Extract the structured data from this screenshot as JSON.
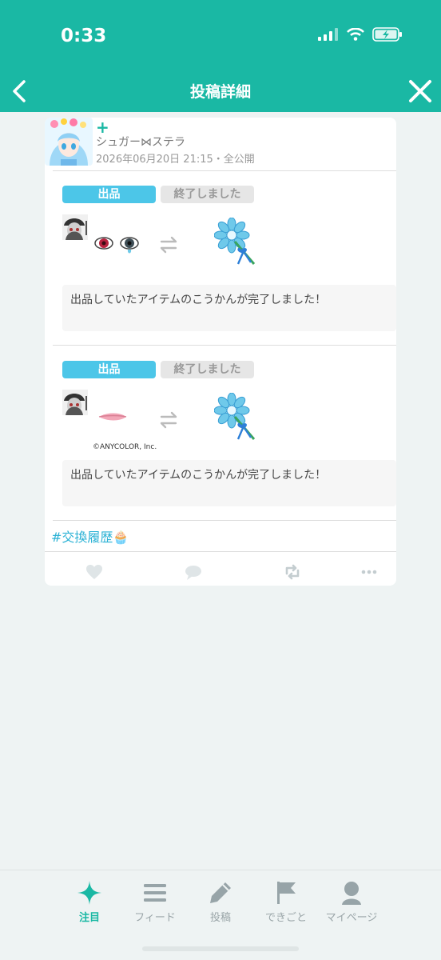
{
  "status_bar": {
    "time": "0:33"
  },
  "nav": {
    "title": "投稿詳細"
  },
  "post": {
    "username": "シュガー⋈ステラ",
    "meta": "2026年06月20日 21:15・全公開",
    "items": [
      {
        "badge": "出品",
        "status": "終了しました",
        "message": "出品していたアイテムのこうかんが完了しました！",
        "copyright": ""
      },
      {
        "badge": "出品",
        "status": "終了しました",
        "message": "出品していたアイテムのこうかんが完了しました！",
        "copyright": "©ANYCOLOR, Inc."
      }
    ],
    "hashtag": "#交換履歴🧁"
  },
  "tabs": [
    {
      "label": "注目",
      "icon": "sparkle-icon",
      "active": true
    },
    {
      "label": "フィード",
      "icon": "menu-icon",
      "active": false
    },
    {
      "label": "投稿",
      "icon": "pencil-icon",
      "active": false
    },
    {
      "label": "できごと",
      "icon": "flag-icon",
      "active": false
    },
    {
      "label": "マイページ",
      "icon": "person-icon",
      "active": false
    }
  ],
  "colors": {
    "accent": "#1ab8a4",
    "badge": "#4cc6e8",
    "hashtag": "#2bb2d5"
  }
}
